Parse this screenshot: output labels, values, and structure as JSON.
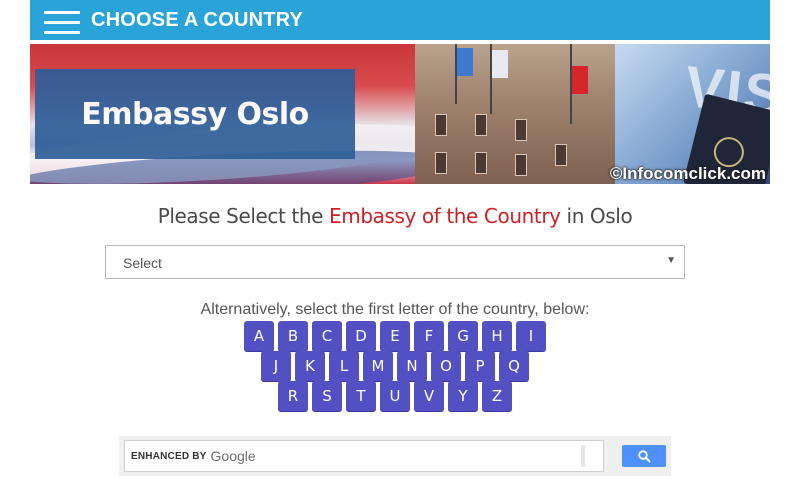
{
  "topbar": {
    "title": "CHOOSE A COUNTRY",
    "menu_icon": "hamburger-menu-icon",
    "color": "#2aa3d8"
  },
  "banner": {
    "title": "Embassy Oslo",
    "watermark": "©Infocomclick.com",
    "visa_text": "VIS"
  },
  "heading": {
    "prefix": "Please Select the ",
    "highlight": "Embassy of the Country",
    "suffix": " in Oslo",
    "highlight_color": "#d21f26"
  },
  "select": {
    "value": "Select"
  },
  "alphabet": {
    "instruction": "Alternatively, select the first letter of the country, below:",
    "rows": [
      [
        "A",
        "B",
        "C",
        "D",
        "E",
        "F",
        "G",
        "H",
        "I"
      ],
      [
        "J",
        "K",
        "L",
        "M",
        "N",
        "O",
        "P",
        "Q"
      ],
      [
        "R",
        "S",
        "T",
        "U",
        "V",
        "Y",
        "Z"
      ]
    ],
    "button_color": "#5350c4"
  },
  "search": {
    "enhanced_label": "ENHANCED BY",
    "brand": "Google",
    "button_icon": "search-icon"
  }
}
